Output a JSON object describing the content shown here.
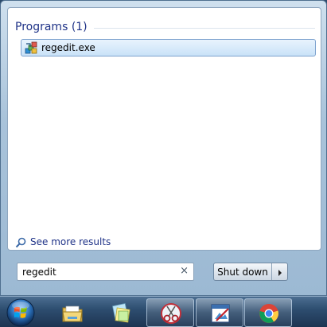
{
  "start_menu": {
    "programs": {
      "title": "Programs (1)",
      "items": [
        {
          "label": "regedit.exe",
          "icon": "regedit-icon",
          "selected": true
        }
      ]
    },
    "see_more": {
      "label": "See more results",
      "icon": "search-icon"
    },
    "search": {
      "value": "regedit",
      "clear_icon": "×"
    },
    "shutdown": {
      "label": "Shut down",
      "arrow_icon": "arrow-right-icon"
    }
  },
  "taskbar": {
    "start_orb": "windows-orb-icon",
    "buttons": [
      {
        "name": "explorer",
        "icon": "folder-icon",
        "state": "pinned"
      },
      {
        "name": "sticky-notes",
        "icon": "sticky-notes-icon",
        "state": "pinned"
      },
      {
        "name": "snipping-tool",
        "icon": "scissors-icon",
        "state": "active"
      },
      {
        "name": "paint-editor",
        "icon": "paint-icon",
        "state": "active"
      },
      {
        "name": "chrome",
        "icon": "chrome-icon",
        "state": "active"
      }
    ]
  },
  "colors": {
    "accent_text": "#1e3287",
    "selection_border": "#7da2ce",
    "taskbar_top": "#4c6e91",
    "taskbar_bottom": "#1d3452"
  }
}
